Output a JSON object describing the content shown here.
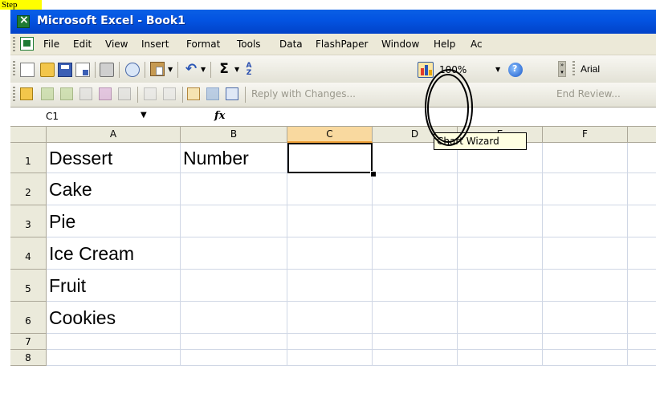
{
  "step_tab": "Step",
  "window": {
    "title": "Microsoft Excel - Book1",
    "menus": [
      "File",
      "Edit",
      "View",
      "Insert",
      "Format",
      "Tools",
      "Data",
      "FlashPaper",
      "Window",
      "Help",
      "Ac"
    ]
  },
  "toolbar": {
    "icons": [
      "new-icon",
      "open-icon",
      "save-icon",
      "permission-icon",
      "print-icon",
      "research-icon",
      "paste-icon",
      "undo-icon",
      "autosum-icon",
      "sort-ascending-icon",
      "chart-wizard-icon",
      "help-icon"
    ],
    "zoom": "100%",
    "font": "Arial"
  },
  "reviewing_toolbar": {
    "reply_with_changes": "Reply with Changes...",
    "end_review": "End Review..."
  },
  "tooltip": "Chart Wizard",
  "formula_bar": {
    "name_box": "C1",
    "fx_label": "fx",
    "formula": ""
  },
  "sheet": {
    "columns": [
      "A",
      "B",
      "C",
      "D",
      "E",
      "F"
    ],
    "selected_column": "C",
    "rows": [
      {
        "num": "1",
        "cells": [
          "Dessert",
          "Number",
          "",
          "",
          "",
          ""
        ]
      },
      {
        "num": "2",
        "cells": [
          "Cake",
          "",
          "",
          "",
          "",
          ""
        ]
      },
      {
        "num": "3",
        "cells": [
          "Pie",
          "",
          "",
          "",
          "",
          ""
        ]
      },
      {
        "num": "4",
        "cells": [
          "Ice Cream",
          "",
          "",
          "",
          "",
          ""
        ]
      },
      {
        "num": "5",
        "cells": [
          "Fruit",
          "",
          "",
          "",
          "",
          ""
        ]
      },
      {
        "num": "6",
        "cells": [
          "Cookies",
          "",
          "",
          "",
          "",
          ""
        ]
      },
      {
        "num": "7",
        "cells": [
          "",
          "",
          "",
          "",
          "",
          ""
        ]
      },
      {
        "num": "8",
        "cells": [
          "",
          "",
          "",
          "",
          "",
          ""
        ]
      }
    ],
    "active_cell": "C1"
  },
  "colors": {
    "title_bar": "#0353e1",
    "tooltip_bg": "#ffffe1",
    "selected_header": "#f9d99f",
    "step_highlight": "#ffff00"
  }
}
